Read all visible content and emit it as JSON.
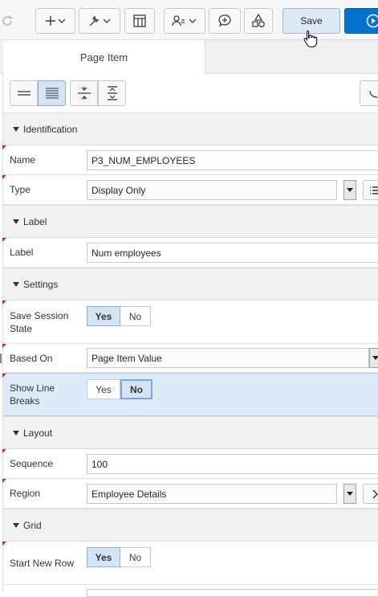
{
  "toolbar": {
    "save_label": "Save",
    "icons": [
      "undo-icon",
      "add-icon",
      "wrench-icon",
      "grid-layout-icon",
      "shared-components-icon",
      "comments-icon",
      "shapes-icon",
      "run-icon"
    ]
  },
  "tabs": {
    "active_label": "Page Item"
  },
  "sections": {
    "identification": "Identification",
    "label": "Label",
    "settings": "Settings",
    "layout": "Layout",
    "grid": "Grid"
  },
  "props": {
    "name": {
      "label": "Name",
      "value": "P3_NUM_EMPLOYEES"
    },
    "type": {
      "label": "Type",
      "value": "Display Only"
    },
    "label": {
      "label": "Label",
      "value": "Num employees"
    },
    "save_session_state": {
      "label": "Save Session State",
      "yes": "Yes",
      "no": "No",
      "selected": "Yes"
    },
    "based_on": {
      "label": "Based On",
      "value": "Page Item Value"
    },
    "show_line_breaks": {
      "label": "Show Line Breaks",
      "yes": "Yes",
      "no": "No",
      "selected": "No"
    },
    "sequence": {
      "label": "Sequence",
      "value": "100"
    },
    "region": {
      "label": "Region",
      "value": "Employee Details"
    },
    "start_new_row": {
      "label": "Start New Row",
      "yes": "Yes",
      "no": "No",
      "selected": "Yes"
    }
  },
  "colors": {
    "accent": "#0572ce",
    "highlight_row": "#ddebf9",
    "toggle_on": "#d4e4f5",
    "required_flag": "#e0241c"
  }
}
